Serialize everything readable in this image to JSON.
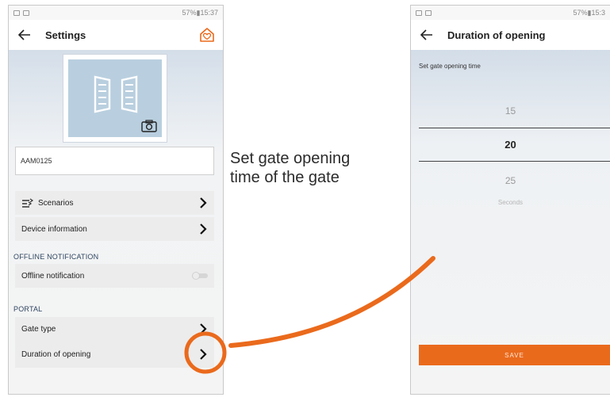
{
  "left_screen": {
    "statusbar": {
      "right": "57%▮15:37"
    },
    "appbar": {
      "title": "Settings",
      "back_icon": "arrow-left-icon",
      "action_icon": "home-heart-icon"
    },
    "device_photo": {
      "icon": "gate-icon",
      "camera_icon": "camera-icon"
    },
    "device_name": "AAM0125",
    "rows": {
      "scenarios": "Scenarios",
      "device_information": "Device information"
    },
    "offline_section": {
      "header": "OFFLINE NOTIFICATION",
      "toggle_label": "Offline notification",
      "toggle_on": false
    },
    "portal_section": {
      "header": "PORTAL",
      "gate_type": "Gate type",
      "duration_of_opening": "Duration of opening"
    }
  },
  "callout": {
    "line1": "Set gate opening",
    "line2": "time of the gate"
  },
  "right_screen": {
    "statusbar": {
      "right": "57%▮15:3"
    },
    "appbar": {
      "title": "Duration of opening",
      "back_icon": "arrow-left-icon"
    },
    "set_label": "Set gate opening time",
    "picker": {
      "prev": "15",
      "selected": "20",
      "next": "25",
      "unit": "Seconds"
    },
    "save_label": "SAVE"
  },
  "colors": {
    "accent": "#ea6a1c",
    "section_header": "#2f4560",
    "photo_bg": "#b9cfdf"
  }
}
